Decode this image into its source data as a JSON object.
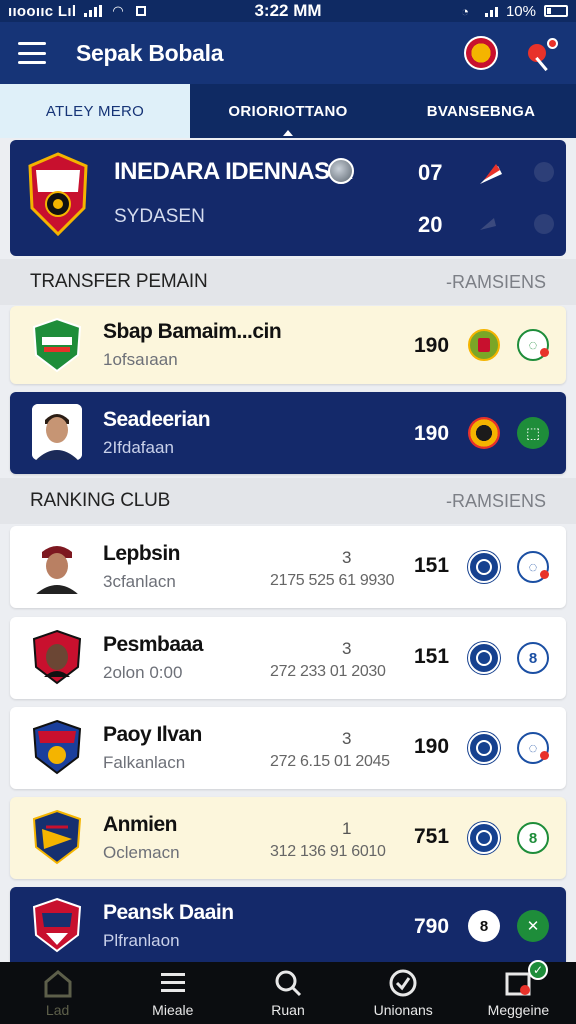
{
  "status_bar": {
    "carrier": "ııooııc Lıl",
    "time": "3:22 MM",
    "battery": "10%"
  },
  "app_bar": {
    "title": "Sepak Bobala"
  },
  "tabs": [
    {
      "label": "ATLEY MERO",
      "active": true
    },
    {
      "label": "ORIORIOTTANO",
      "active": false
    },
    {
      "label": "BVANSEBNGA",
      "active": false
    }
  ],
  "featured": {
    "team": "INEDARA IDENNASIA",
    "subtitle": "SYDASEN",
    "score_top": "07",
    "score_bottom": "20"
  },
  "transfer_section": {
    "title": "TRANSFER PEMAIN",
    "link": "-RAMSIENS",
    "items": [
      {
        "name": "Sbap Bamaim...cin",
        "sub": "1ofsaıaan",
        "score": "190",
        "style": "cream"
      },
      {
        "name": "Seadeerian",
        "sub": "2Ifdafaan",
        "score": "190",
        "style": "navy"
      }
    ]
  },
  "ranking_section": {
    "title": "RANKING CLUB",
    "link": "-RAMSIENS",
    "items": [
      {
        "name": "Lepbsin",
        "sub": "3cfanlacn",
        "rank": "3",
        "code": "2175 525 61 9930",
        "score": "151",
        "style": "white"
      },
      {
        "name": "Pesmbaaa",
        "sub": "2olon 0:00",
        "rank": "3",
        "code": "272 233 01 2030",
        "score": "151",
        "style": "white"
      },
      {
        "name": "Paoy Ilvan",
        "sub": "Falkanlacn",
        "rank": "3",
        "code": "272 6.15 01 2045",
        "score": "190",
        "style": "white"
      },
      {
        "name": "Anmien",
        "sub": "Oclemacn",
        "rank": "1",
        "code": "312 136 91 6010",
        "score": "751",
        "style": "cream"
      },
      {
        "name": "Peansk Daain",
        "sub": "Plfranlaon",
        "rank": "",
        "code": "",
        "score": "790",
        "style": "navy"
      }
    ]
  },
  "bottom_nav": [
    {
      "label": "Lad",
      "icon": "home-icon",
      "active": true
    },
    {
      "label": "Mieale",
      "icon": "menu-lines-icon",
      "active": false
    },
    {
      "label": "Ruan",
      "icon": "search-icon",
      "active": false
    },
    {
      "label": "Unionans",
      "icon": "check-circle-icon",
      "active": false
    },
    {
      "label": "Meggeine",
      "icon": "inbox-icon",
      "active": false,
      "badge": "✓"
    }
  ],
  "colors": {
    "primary": "#163477",
    "navy": "#14296a",
    "tab_active_bg": "#dff0f9",
    "card_cream": "#fcf6dc",
    "accent_red": "#e8322a",
    "accent_green": "#1e8d3a"
  }
}
